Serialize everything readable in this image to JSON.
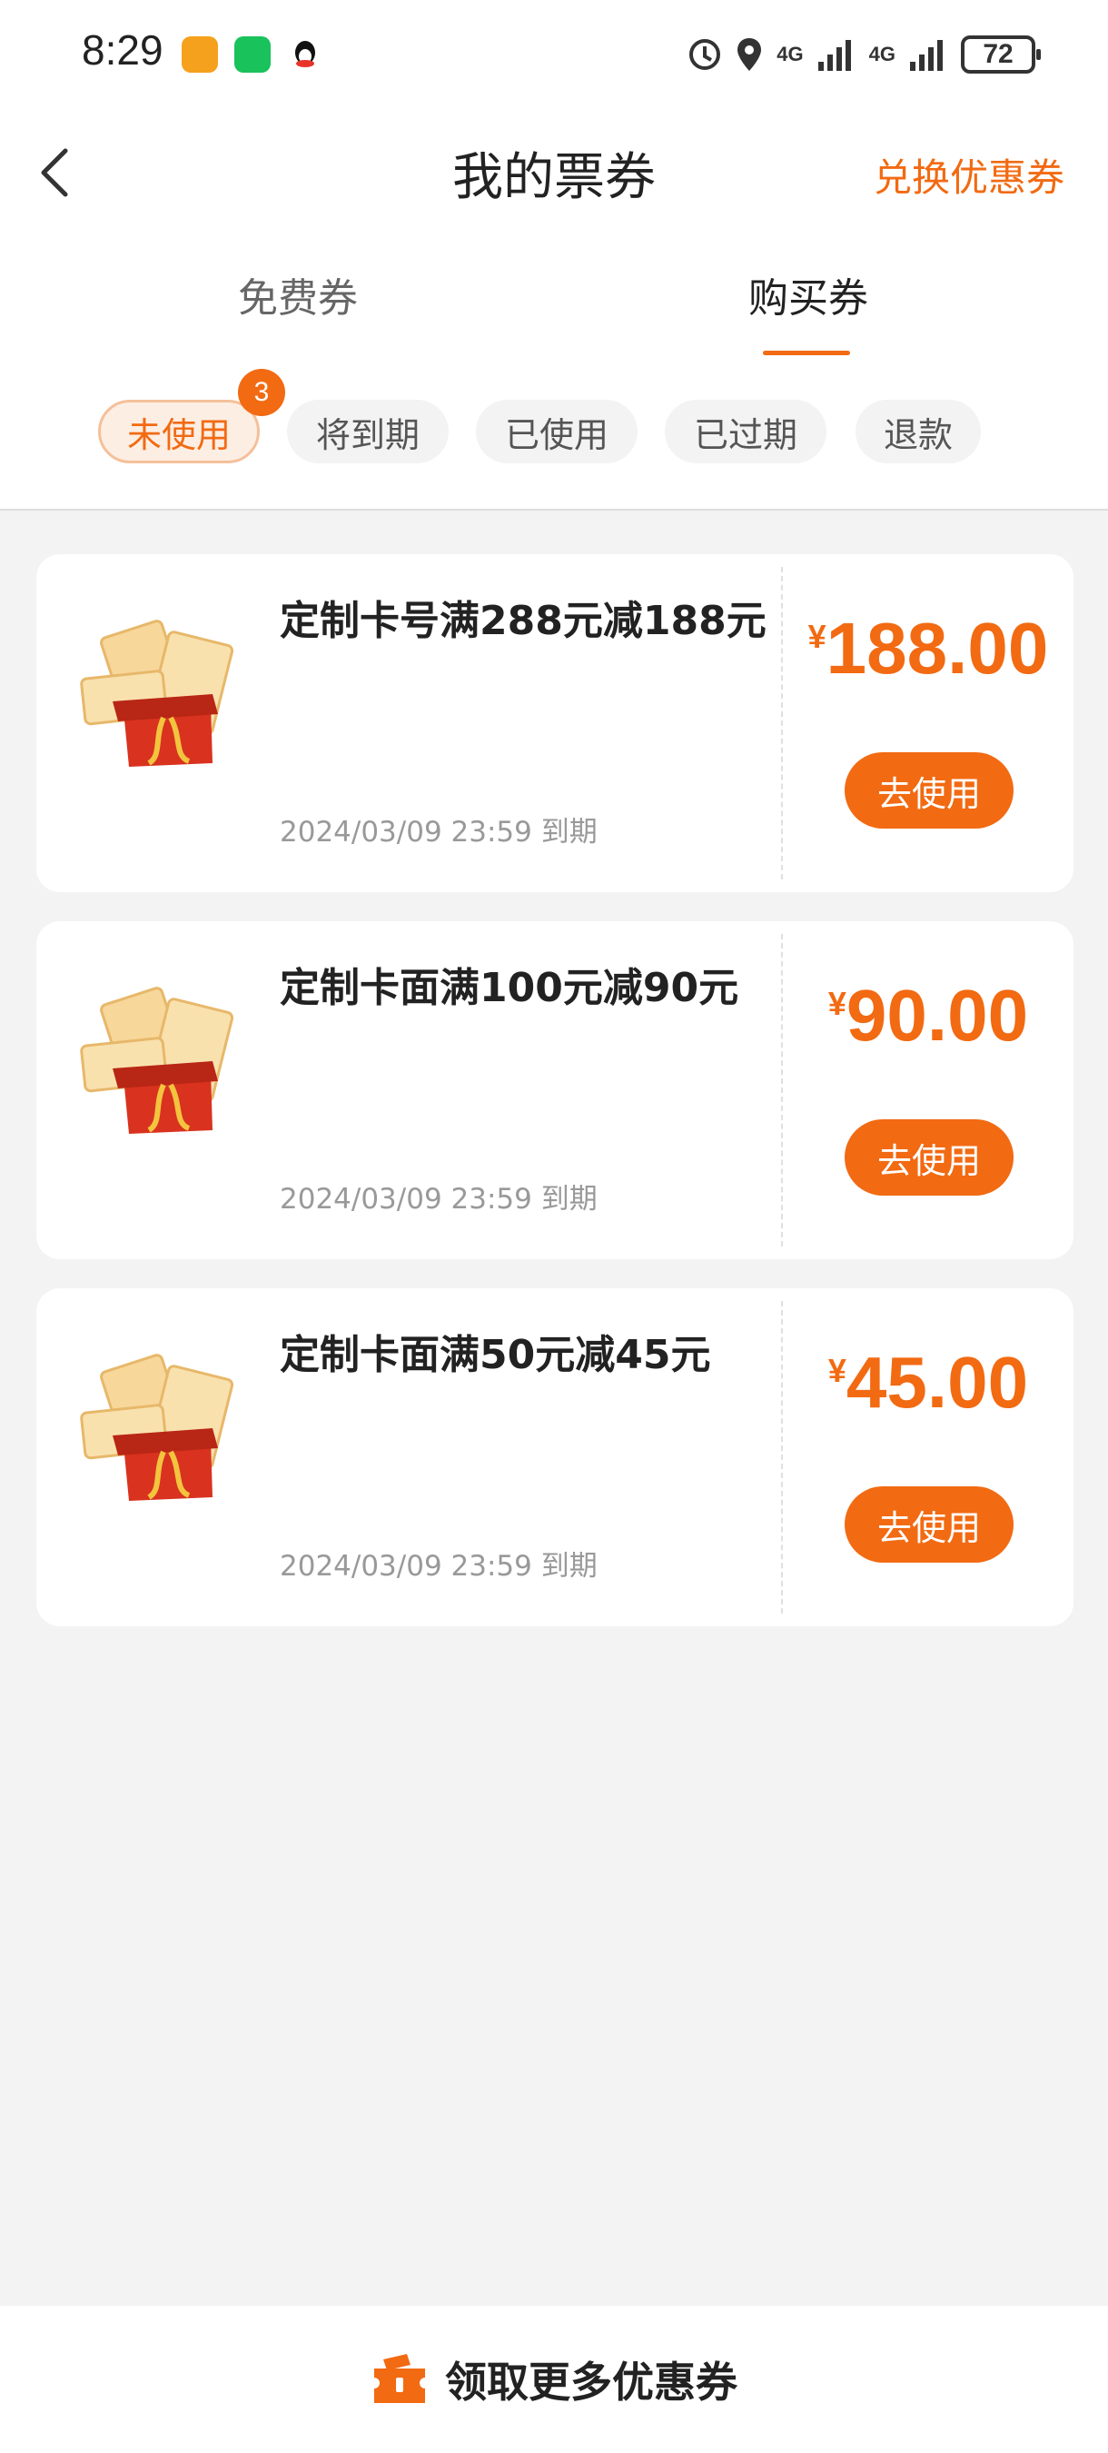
{
  "status_bar": {
    "time": "8:29",
    "network_1": "4G",
    "network_2": "4G",
    "battery": "72"
  },
  "header": {
    "title": "我的票券",
    "exchange_label": "兑换优惠券"
  },
  "tabs": [
    {
      "label": "免费券",
      "active": false
    },
    {
      "label": "购买券",
      "active": true
    }
  ],
  "filters": {
    "items": [
      "未使用",
      "将到期",
      "已使用",
      "已过期",
      "退款"
    ],
    "active_index": 0,
    "unused_count": "3"
  },
  "coupons": [
    {
      "title": "定制卡号满288元减188元",
      "expiry": "2024/03/09 23:59 到期",
      "currency": "¥",
      "amount": "188.00",
      "button": "去使用"
    },
    {
      "title": "定制卡面满100元减90元",
      "expiry": "2024/03/09 23:59 到期",
      "currency": "¥",
      "amount": "90.00",
      "button": "去使用"
    },
    {
      "title": "定制卡面满50元减45元",
      "expiry": "2024/03/09 23:59 到期",
      "currency": "¥",
      "amount": "45.00",
      "button": "去使用"
    }
  ],
  "footer": {
    "more_coupons_label": "领取更多优惠券"
  },
  "colors": {
    "accent": "#f26a12",
    "background": "#f3f3f3",
    "card": "#ffffff"
  },
  "icons": {
    "back": "chevron-left-icon",
    "gift": "gift-box-icon",
    "ticket": "ticket-icon"
  }
}
